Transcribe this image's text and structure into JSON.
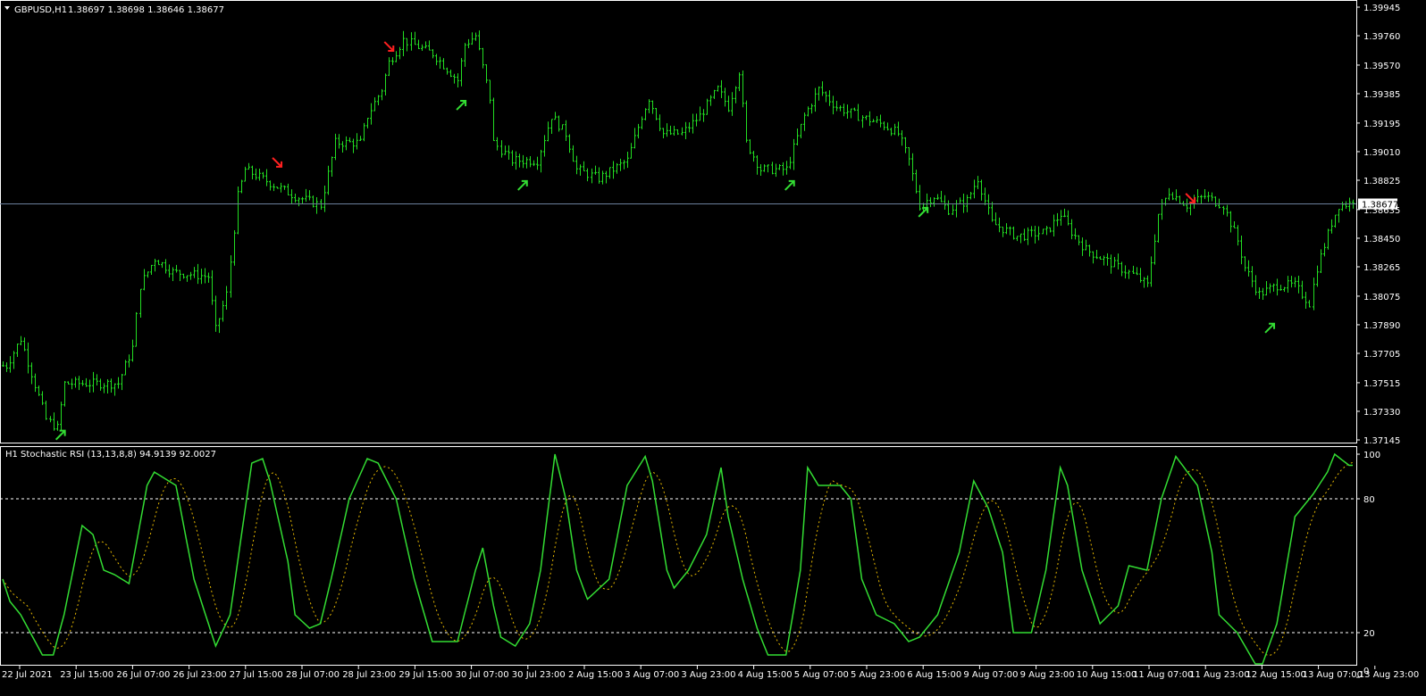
{
  "header": {
    "symbol": "GBPUSD,H1",
    "ohlc": "1.38697 1.38698 1.38646 1.38677",
    "menu_icon": "triangle-down-icon"
  },
  "indicator": {
    "label": "H1 Stochastic RSI (13,13,8,8) 94.9139 92.0027"
  },
  "colors": {
    "background": "#000000",
    "bars": "#22dd22",
    "stoch_main": "#33dd33",
    "stoch_signal": "#e6b800",
    "current_price_line": "#6c7f9c",
    "buy_arrow": "#33dd33",
    "sell_arrow": "#ff2020",
    "axis": "#ffffff"
  },
  "chart_data": [
    {
      "type": "ohlc",
      "symbol": "GBPUSD",
      "timeframe": "H1",
      "current_price": "1.38677",
      "ylim": [
        1.37145,
        1.39945
      ],
      "price_ticks": [
        "1.39945",
        "1.39760",
        "1.39570",
        "1.39385",
        "1.39195",
        "1.39010",
        "1.38825",
        "1.38635",
        "1.38450",
        "1.38265",
        "1.38075",
        "1.37890",
        "1.37705",
        "1.37515",
        "1.37330",
        "1.37145"
      ],
      "time_ticks": [
        "22 Jul 2021",
        "23 Jul 15:00",
        "26 Jul 07:00",
        "26 Jul 23:00",
        "27 Jul 15:00",
        "28 Jul 07:00",
        "28 Jul 23:00",
        "29 Jul 15:00",
        "30 Jul 07:00",
        "30 Jul 23:00",
        "2 Aug 15:00",
        "3 Aug 07:00",
        "3 Aug 23:00",
        "4 Aug 15:00",
        "5 Aug 07:00",
        "5 Aug 23:00",
        "6 Aug 15:00",
        "9 Aug 07:00",
        "9 Aug 23:00",
        "10 Aug 15:00",
        "11 Aug 07:00",
        "11 Aug 23:00",
        "12 Aug 15:00",
        "13 Aug 07:00",
        "13 Aug 23:00"
      ],
      "bar_count": 375,
      "close_path_bar_price": [
        [
          1,
          1.37625
        ],
        [
          5,
          1.37799
        ],
        [
          12,
          1.37279
        ],
        [
          15,
          1.37222
        ],
        [
          17,
          1.3751
        ],
        [
          25,
          1.3751
        ],
        [
          32,
          1.3751
        ],
        [
          36,
          1.37741
        ],
        [
          38,
          1.38145
        ],
        [
          42,
          1.38318
        ],
        [
          47,
          1.38231
        ],
        [
          57,
          1.38202
        ],
        [
          59,
          1.37856
        ],
        [
          62,
          1.38087
        ],
        [
          65,
          1.38722
        ],
        [
          67,
          1.38895
        ],
        [
          74,
          1.38808
        ],
        [
          81,
          1.38722
        ],
        [
          88,
          1.38664
        ],
        [
          92,
          1.39068
        ],
        [
          99,
          1.39068
        ],
        [
          101,
          1.39241
        ],
        [
          105,
          1.39414
        ],
        [
          107,
          1.39587
        ],
        [
          111,
          1.39732
        ],
        [
          119,
          1.39645
        ],
        [
          126,
          1.39472
        ],
        [
          128,
          1.39703
        ],
        [
          131,
          1.3976
        ],
        [
          135,
          1.39356
        ],
        [
          136,
          1.39068
        ],
        [
          141,
          1.38953
        ],
        [
          148,
          1.38953
        ],
        [
          152,
          1.39241
        ],
        [
          156,
          1.39126
        ],
        [
          159,
          1.38895
        ],
        [
          165,
          1.38837
        ],
        [
          173,
          1.38953
        ],
        [
          177,
          1.39241
        ],
        [
          179,
          1.39356
        ],
        [
          183,
          1.39126
        ],
        [
          188,
          1.39126
        ],
        [
          193,
          1.39241
        ],
        [
          198,
          1.39414
        ],
        [
          201,
          1.39299
        ],
        [
          204,
          1.3953
        ],
        [
          206,
          1.39068
        ],
        [
          210,
          1.38895
        ],
        [
          217,
          1.38895
        ],
        [
          222,
          1.39241
        ],
        [
          226,
          1.39414
        ],
        [
          231,
          1.39299
        ],
        [
          237,
          1.39241
        ],
        [
          244,
          1.39183
        ],
        [
          248,
          1.39126
        ],
        [
          251,
          1.38953
        ],
        [
          254,
          1.38664
        ],
        [
          258,
          1.38722
        ],
        [
          262,
          1.38635
        ],
        [
          267,
          1.38693
        ],
        [
          270,
          1.38837
        ],
        [
          274,
          1.38549
        ],
        [
          281,
          1.38462
        ],
        [
          289,
          1.38491
        ],
        [
          293,
          1.38606
        ],
        [
          296,
          1.38491
        ],
        [
          300,
          1.38376
        ],
        [
          307,
          1.38289
        ],
        [
          314,
          1.38202
        ],
        [
          317,
          1.38145
        ],
        [
          320,
          1.38606
        ],
        [
          323,
          1.38751
        ],
        [
          328,
          1.38664
        ],
        [
          333,
          1.38722
        ],
        [
          338,
          1.38664
        ],
        [
          342,
          1.38433
        ],
        [
          344,
          1.3826
        ],
        [
          348,
          1.38087
        ],
        [
          353,
          1.38145
        ],
        [
          358,
          1.38145
        ],
        [
          362,
          1.38029
        ],
        [
          364,
          1.3826
        ],
        [
          368,
          1.38549
        ],
        [
          370,
          1.38664
        ],
        [
          374,
          1.38677
        ]
      ],
      "signals": [
        {
          "type": "buy",
          "bar": 16,
          "price": 1.37222
        },
        {
          "type": "sell",
          "bar": 76,
          "price": 1.38895
        },
        {
          "type": "sell",
          "bar": 107,
          "price": 1.39645
        },
        {
          "type": "buy",
          "bar": 127,
          "price": 1.39356
        },
        {
          "type": "buy",
          "bar": 144,
          "price": 1.38837
        },
        {
          "type": "buy",
          "bar": 218,
          "price": 1.38837
        },
        {
          "type": "buy",
          "bar": 255,
          "price": 1.38664
        },
        {
          "type": "sell",
          "bar": 329,
          "price": 1.38664
        },
        {
          "type": "buy",
          "bar": 351,
          "price": 1.37914
        }
      ]
    },
    {
      "type": "line",
      "title": "H1 Stochastic RSI (13,13,8,8)",
      "ylim": [
        0,
        100
      ],
      "y_ticks": [
        "100",
        "80",
        "20",
        "0"
      ],
      "levels": [
        80,
        20
      ],
      "series": [
        {
          "role": "main",
          "last": 94.9139,
          "bar_value": [
            [
              0,
              44
            ],
            [
              2,
              34
            ],
            [
              5,
              28
            ],
            [
              11,
              10
            ],
            [
              14,
              10
            ],
            [
              17,
              28
            ],
            [
              22,
              68
            ],
            [
              25,
              64
            ],
            [
              28,
              48
            ],
            [
              31,
              46
            ],
            [
              35,
              42
            ],
            [
              40,
              86
            ],
            [
              42,
              92
            ],
            [
              48,
              86
            ],
            [
              53,
              44
            ],
            [
              59,
              14
            ],
            [
              63,
              28
            ],
            [
              69,
              96
            ],
            [
              72,
              98
            ],
            [
              74,
              88
            ],
            [
              79,
              52
            ],
            [
              81,
              28
            ],
            [
              85,
              22
            ],
            [
              88,
              24
            ],
            [
              91,
              44
            ],
            [
              96,
              80
            ],
            [
              101,
              98
            ],
            [
              104,
              96
            ],
            [
              109,
              80
            ],
            [
              114,
              44
            ],
            [
              119,
              16
            ],
            [
              126,
              16
            ],
            [
              131,
              48
            ],
            [
              133,
              58
            ],
            [
              136,
              32
            ],
            [
              138,
              18
            ],
            [
              142,
              14
            ],
            [
              146,
              24
            ],
            [
              149,
              48
            ],
            [
              153,
              100
            ],
            [
              156,
              80
            ],
            [
              159,
              48
            ],
            [
              162,
              35
            ],
            [
              164,
              38
            ],
            [
              168,
              44
            ],
            [
              173,
              86
            ],
            [
              178,
              99
            ],
            [
              180,
              88
            ],
            [
              184,
              48
            ],
            [
              186,
              40
            ],
            [
              190,
              48
            ],
            [
              195,
              64
            ],
            [
              199,
              94
            ],
            [
              201,
              72
            ],
            [
              205,
              44
            ],
            [
              209,
              22
            ],
            [
              212,
              10
            ],
            [
              217,
              10
            ],
            [
              221,
              48
            ],
            [
              223,
              94
            ],
            [
              226,
              86
            ],
            [
              232,
              86
            ],
            [
              235,
              80
            ],
            [
              238,
              44
            ],
            [
              242,
              28
            ],
            [
              247,
              24
            ],
            [
              251,
              16
            ],
            [
              254,
              18
            ],
            [
              259,
              28
            ],
            [
              265,
              56
            ],
            [
              269,
              88
            ],
            [
              273,
              76
            ],
            [
              277,
              56
            ],
            [
              280,
              20
            ],
            [
              285,
              20
            ],
            [
              289,
              48
            ],
            [
              293,
              94
            ],
            [
              295,
              86
            ],
            [
              299,
              48
            ],
            [
              304,
              24
            ],
            [
              309,
              32
            ],
            [
              312,
              50
            ],
            [
              317,
              48
            ],
            [
              321,
              80
            ],
            [
              325,
              99
            ],
            [
              331,
              86
            ],
            [
              335,
              56
            ],
            [
              337,
              28
            ],
            [
              342,
              20
            ],
            [
              347,
              6
            ],
            [
              349,
              6
            ],
            [
              353,
              24
            ],
            [
              358,
              72
            ],
            [
              363,
              82
            ],
            [
              367,
              92
            ],
            [
              369,
              100
            ],
            [
              373,
              95
            ]
          ]
        },
        {
          "role": "signal",
          "last": 92.0027
        }
      ]
    }
  ]
}
